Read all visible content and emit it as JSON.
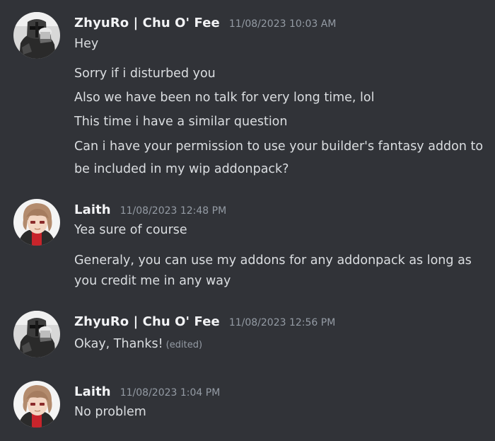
{
  "colors": {
    "background": "#313338",
    "username": "#f2f3f5",
    "text": "#dbdee1",
    "muted": "#949ba4"
  },
  "messages": [
    {
      "author": "ZhyuRo | Chu O' Fee",
      "timestamp": "11/08/2023 10:03 AM",
      "avatar": "helmet-avatar-icon",
      "lines": [
        "Hey",
        "Sorry if i disturbed you",
        "Also we have been no talk for very long time, lol",
        "This time i have a similar question",
        "Can i have your permission to use your builder's fantasy addon to",
        "be included in my wip addonpack?"
      ]
    },
    {
      "author": "Laith",
      "timestamp": "11/08/2023 12:48 PM",
      "avatar": "anime-character-avatar-icon",
      "lines": [
        "Yea sure of course",
        "Generaly, you can use my addons for any addonpack as long as",
        "you credit me in any way"
      ]
    },
    {
      "author": "ZhyuRo | Chu O' Fee",
      "timestamp": "11/08/2023 12:56 PM",
      "avatar": "helmet-avatar-icon",
      "lines": [
        "Okay, Thanks!"
      ],
      "edited_label": "(edited)"
    },
    {
      "author": "Laith",
      "timestamp": "11/08/2023 1:04 PM",
      "avatar": "anime-character-avatar-icon",
      "lines": [
        "No problem"
      ]
    }
  ]
}
